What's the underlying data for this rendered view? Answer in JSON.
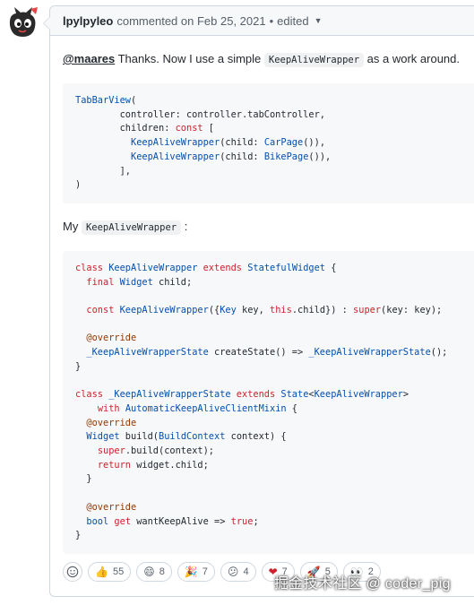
{
  "comment": {
    "author": "lpylpyleo",
    "action": "commented on",
    "date": "Feb 25, 2021",
    "separator": "•",
    "edited": "edited",
    "mention": "@maares",
    "para1_text_a": " Thanks. Now I use a simple ",
    "para1_code": "KeepAliveWrapper",
    "para1_text_b": " as a work around.",
    "para2_text": "My ",
    "para2_code": "KeepAliveWrapper",
    "para2_colon": " :"
  },
  "reactions": [
    {
      "icon": "thumbs-up-icon",
      "emoji": "👍",
      "count": "55"
    },
    {
      "icon": "laugh-icon",
      "emoji": "😄",
      "count": "8"
    },
    {
      "icon": "tada-icon",
      "emoji": "🎉",
      "count": "7"
    },
    {
      "icon": "confused-icon",
      "emoji": "😕",
      "count": "4"
    },
    {
      "icon": "heart-icon",
      "emoji": "❤",
      "count": "7"
    },
    {
      "icon": "rocket-icon",
      "emoji": "🚀",
      "count": "5"
    },
    {
      "icon": "eyes-icon",
      "emoji": "👀",
      "count": "2"
    }
  ],
  "watermark": "掘金技术社区 @ coder_pig",
  "colors": {
    "border": "#d0d7de",
    "header_bg": "#f6f8fa",
    "keyword": "#cf222e",
    "type": "#0550ae"
  }
}
